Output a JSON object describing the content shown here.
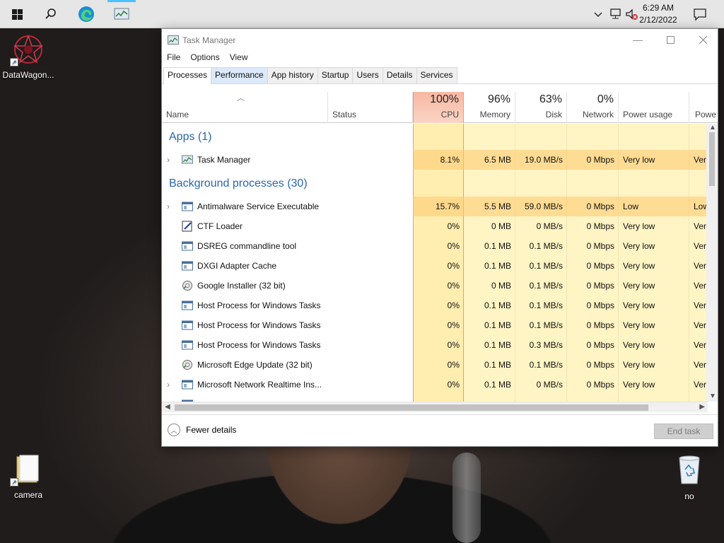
{
  "taskbar": {
    "time": "6:29 AM",
    "date": "2/12/2022"
  },
  "desktop": {
    "icons": [
      {
        "label": "DataWagon..."
      },
      {
        "label": "camera"
      },
      {
        "label": "no"
      }
    ]
  },
  "window": {
    "title": "Task Manager",
    "menu": [
      "File",
      "Options",
      "View"
    ],
    "tabs": [
      "Processes",
      "Performance",
      "App history",
      "Startup",
      "Users",
      "Details",
      "Services"
    ],
    "active_tab": "Processes",
    "columns": {
      "name": "Name",
      "status": "Status",
      "cpu": {
        "pct": "100%",
        "label": "CPU"
      },
      "memory": {
        "pct": "96%",
        "label": "Memory"
      },
      "disk": {
        "pct": "63%",
        "label": "Disk"
      },
      "network": {
        "pct": "0%",
        "label": "Network"
      },
      "power": "Power usage",
      "power_trend": "Powe"
    },
    "groups": {
      "apps": "Apps (1)",
      "background": "Background processes (30)"
    },
    "apps": [
      {
        "name": "Task Manager",
        "cpu": "8.1%",
        "memory": "6.5 MB",
        "disk": "19.0 MB/s",
        "network": "0 Mbps",
        "power": "Very low",
        "trend": "Ver"
      }
    ],
    "background": [
      {
        "name": "Antimalware Service Executable",
        "cpu": "15.7%",
        "memory": "5.5 MB",
        "disk": "59.0 MB/s",
        "network": "0 Mbps",
        "power": "Low",
        "trend": "Low"
      },
      {
        "name": "CTF Loader",
        "cpu": "0%",
        "memory": "0 MB",
        "disk": "0 MB/s",
        "network": "0 Mbps",
        "power": "Very low",
        "trend": "Ver"
      },
      {
        "name": "DSREG commandline tool",
        "cpu": "0%",
        "memory": "0.1 MB",
        "disk": "0.1 MB/s",
        "network": "0 Mbps",
        "power": "Very low",
        "trend": "Ver"
      },
      {
        "name": "DXGI Adapter Cache",
        "cpu": "0%",
        "memory": "0.1 MB",
        "disk": "0.1 MB/s",
        "network": "0 Mbps",
        "power": "Very low",
        "trend": "Ver"
      },
      {
        "name": "Google Installer (32 bit)",
        "cpu": "0%",
        "memory": "0 MB",
        "disk": "0.1 MB/s",
        "network": "0 Mbps",
        "power": "Very low",
        "trend": "Ver"
      },
      {
        "name": "Host Process for Windows Tasks",
        "cpu": "0%",
        "memory": "0.1 MB",
        "disk": "0.1 MB/s",
        "network": "0 Mbps",
        "power": "Very low",
        "trend": "Ver"
      },
      {
        "name": "Host Process for Windows Tasks",
        "cpu": "0%",
        "memory": "0.1 MB",
        "disk": "0.1 MB/s",
        "network": "0 Mbps",
        "power": "Very low",
        "trend": "Ver"
      },
      {
        "name": "Host Process for Windows Tasks",
        "cpu": "0%",
        "memory": "0.1 MB",
        "disk": "0.3 MB/s",
        "network": "0 Mbps",
        "power": "Very low",
        "trend": "Ver"
      },
      {
        "name": "Microsoft Edge Update (32 bit)",
        "cpu": "0%",
        "memory": "0.1 MB",
        "disk": "0.1 MB/s",
        "network": "0 Mbps",
        "power": "Very low",
        "trend": "Ver"
      },
      {
        "name": "Microsoft Network Realtime Ins...",
        "cpu": "0%",
        "memory": "0.1 MB",
        "disk": "0 MB/s",
        "network": "0 Mbps",
        "power": "Very low",
        "trend": "Ver"
      }
    ],
    "footer": {
      "fewer_details": "Fewer details",
      "end_task": "End task"
    }
  },
  "colors": {
    "cpu_header": "#f7b7a3",
    "heat_light": "#fff4c4",
    "group_text": "#2a66b0",
    "accent": "#4cc2ff"
  }
}
